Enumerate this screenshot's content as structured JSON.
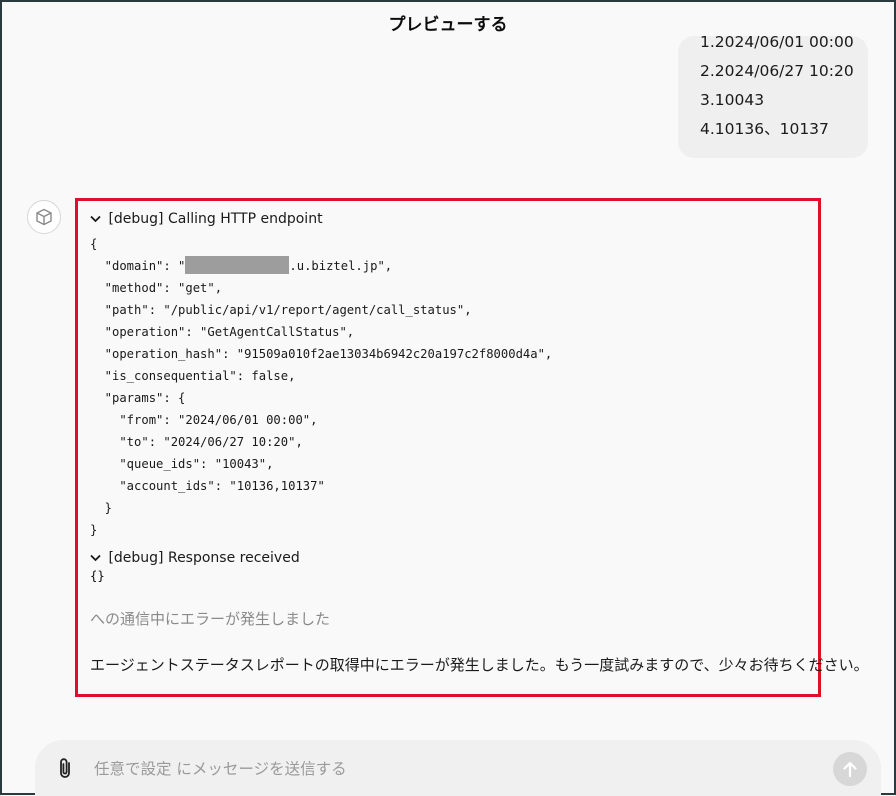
{
  "header": {
    "title": "プレビューする"
  },
  "user_message": {
    "lines": [
      "1.2024/06/01 00:00",
      "2.2024/06/27 10:20",
      "3.10043",
      "4.10136、10137"
    ]
  },
  "bot": {
    "avatar_icon": "cube-icon",
    "call": {
      "title": "[debug] Calling HTTP endpoint",
      "lines": [
        "{",
        "  \"domain\": \"",
        "  \"method\": \"get\",",
        "  \"path\": \"/public/api/v1/report/agent/call_status\",",
        "  \"operation\": \"GetAgentCallStatus\",",
        "  \"operation_hash\": \"91509a010f2ae13034b6942c20a197c2f8000d4a\",",
        "  \"is_consequential\": false,",
        "  \"params\": {",
        "    \"from\": \"2024/06/01 00:00\",",
        "    \"to\": \"2024/06/27 10:20\",",
        "    \"queue_ids\": \"10043\",",
        "    \"account_ids\": \"10136,10137\"",
        "  }",
        "}"
      ],
      "domain_suffix": ".u.biztel.jp\","
    },
    "response": {
      "title": "[debug] Response received",
      "body": "{}"
    },
    "error_line": "への通信中にエラーが発生しました",
    "message": "エージェントステータスレポートの取得中にエラーが発生しました。もう一度試みますので、少々お待ちください。"
  },
  "composer": {
    "placeholder": "任意で設定 にメッセージを送信する",
    "attach_icon": "paperclip-icon",
    "send_icon": "arrow-up-icon"
  },
  "colors": {
    "highlight_border": "#e0102a",
    "redaction": "#9d9d9d"
  }
}
